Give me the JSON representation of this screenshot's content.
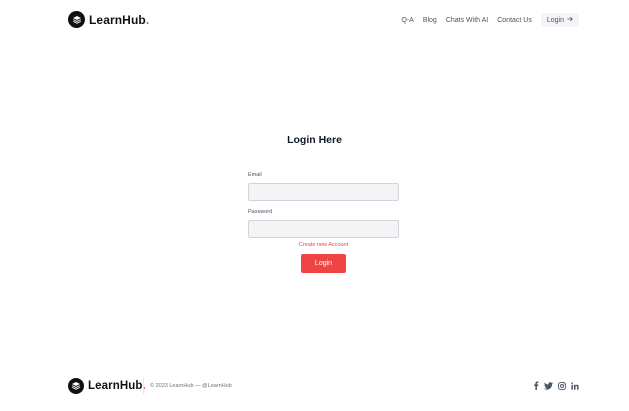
{
  "brand": {
    "name": "LearnHub",
    "dot": "."
  },
  "nav": {
    "links": [
      "Q-A",
      "Blog",
      "Chats With AI",
      "Contact Us"
    ],
    "login_label": "Login",
    "login_icon": "arrow-right-icon"
  },
  "login": {
    "title": "Login Here",
    "email_label": "Email",
    "email_value": "",
    "password_label": "Password",
    "password_value": "",
    "create_account_label": "Create new Account",
    "submit_label": "Login"
  },
  "footer": {
    "copyright": "© 2023 LearnHub — @LearnHub",
    "socials": [
      "facebook-icon",
      "twitter-icon",
      "instagram-icon",
      "linkedin-icon"
    ]
  },
  "colors": {
    "accent": "#ef4444",
    "text_dark": "#111111",
    "input_bg": "#f3f4f6"
  }
}
